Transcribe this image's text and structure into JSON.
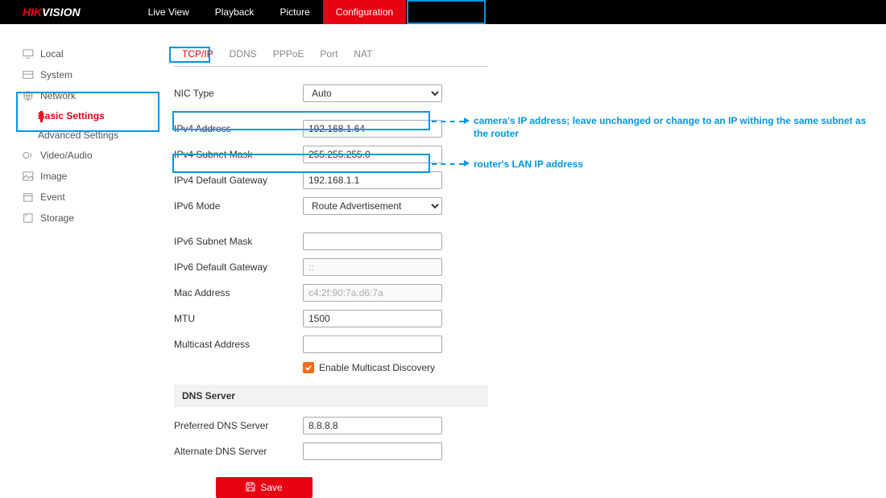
{
  "logo": {
    "redPart": "HIK",
    "whitePart": "VISION"
  },
  "nav": [
    {
      "label": "Live View",
      "active": false
    },
    {
      "label": "Playback",
      "active": false
    },
    {
      "label": "Picture",
      "active": false
    },
    {
      "label": "Configuration",
      "active": true
    }
  ],
  "side": {
    "items": [
      "Local",
      "System",
      "Network",
      "Video/Audio",
      "Image",
      "Event",
      "Storage"
    ],
    "networkSubs": [
      "Basic Settings",
      "Advanced Settings"
    ],
    "activeSub": 0
  },
  "tabs": [
    "TCP/IP",
    "DDNS",
    "PPPoE",
    "Port",
    "NAT"
  ],
  "fields": {
    "nic_type_label": "NIC Type",
    "nic_type_value": "Auto",
    "ipv4_addr_label": "IPv4 Address",
    "ipv4_addr_value": "192.168.1.64",
    "ipv4_mask_label": "IPv4 Subnet Mask",
    "ipv4_mask_value": "255.255.255.0",
    "ipv4_gw_label": "IPv4 Default Gateway",
    "ipv4_gw_value": "192.168.1.1",
    "ipv6_mode_label": "IPv6 Mode",
    "ipv6_mode_value": "Route Advertisement",
    "ipv6_mask_label": "IPv6 Subnet Mask",
    "ipv6_mask_value": "",
    "ipv6_gw_label": "IPv6 Default Gateway",
    "ipv6_gw_value": "::",
    "mac_label": "Mac Address",
    "mac_value": "c4:2f:90:7a:d6:7a",
    "mtu_label": "MTU",
    "mtu_value": "1500",
    "multicast_label": "Multicast Address",
    "multicast_value": "",
    "enable_md": "Enable Multicast Discovery",
    "dns_head": "DNS Server",
    "pri_dns_label": "Preferred DNS Server",
    "pri_dns_value": "8.8.8.8",
    "alt_dns_label": "Alternate DNS Server",
    "alt_dns_value": ""
  },
  "save": "Save",
  "annotations": {
    "ipv4_addr": "camera's IP address; leave unchanged or change to an IP withing the same subnet as the router",
    "ipv4_gw": "router's LAN IP address"
  }
}
